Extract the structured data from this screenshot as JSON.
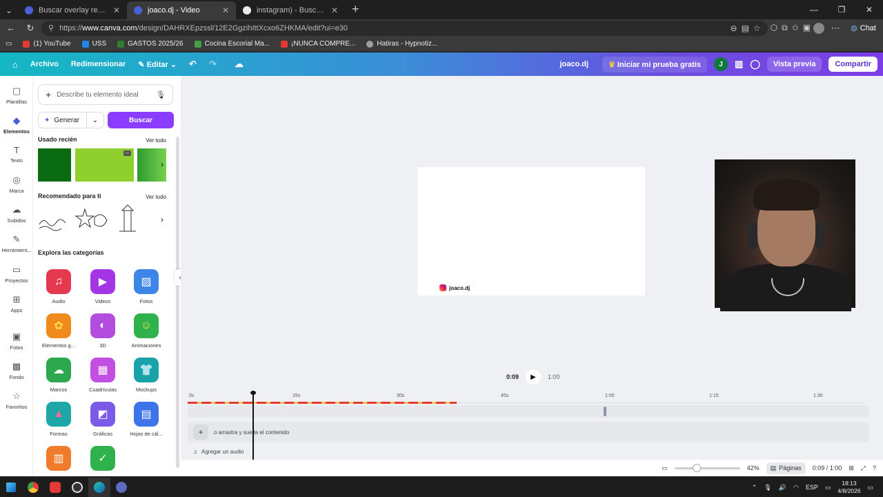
{
  "browser": {
    "tabs": [
      {
        "title": "Buscar overlay redes - Canva",
        "active": false,
        "color": "#4b5fd6"
      },
      {
        "title": "joaco.dj - Video",
        "active": true,
        "color": "#4b5fd6"
      },
      {
        "title": "instagram) - Buscar con Google",
        "active": false,
        "color": "#e8eaed"
      }
    ],
    "url_prefix": "https://",
    "url_host": "www.canva.com",
    "url_path": "/design/DAHRXEpzssl/12E2GgzihIttXcxo6ZHKMA/edit?ui=e30",
    "chat_label": "Chat",
    "bookmarks": [
      {
        "label": "(1) YouTube",
        "color": "#e53935"
      },
      {
        "label": "USS",
        "color": "#1e88e5"
      },
      {
        "label": "GASTOS 2025/26",
        "color": "#2e7d32"
      },
      {
        "label": "Cocina Escorial Ma...",
        "color": "#43a047"
      },
      {
        "label": "¡NUNCA COMPRE...",
        "color": "#e53935"
      },
      {
        "label": "Hatiras - Hypnotiz...",
        "color": "#9e9e9e"
      }
    ]
  },
  "header": {
    "archivo": "Archivo",
    "redimensionar": "Redimensionar",
    "editar": "Editar",
    "project_name": "joaco.dj",
    "trial": "Iniciar mi prueba gratis",
    "avatar_initial": "J",
    "preview": "Vista previa",
    "share": "Compartir"
  },
  "rail": [
    {
      "label": "Plantillas",
      "icon": "template-icon",
      "glyph": "▢"
    },
    {
      "label": "Elementos",
      "icon": "elements-icon",
      "glyph": "◆",
      "active": true
    },
    {
      "label": "Texto",
      "icon": "text-icon",
      "glyph": "T"
    },
    {
      "label": "Marca",
      "icon": "brand-icon",
      "glyph": "◎"
    },
    {
      "label": "Subidos",
      "icon": "upload-icon",
      "glyph": "☁"
    },
    {
      "label": "Herramient...",
      "icon": "tools-icon",
      "glyph": "✎"
    },
    {
      "label": "Proyectos",
      "icon": "folder-icon",
      "glyph": "▭"
    },
    {
      "label": "Apps",
      "icon": "apps-icon",
      "glyph": "⊞"
    },
    {
      "label": "Fotos",
      "icon": "photo-icon",
      "glyph": "▣"
    },
    {
      "label": "Fondo",
      "icon": "background-icon",
      "glyph": "▩"
    },
    {
      "label": "Favoritos",
      "icon": "star-icon",
      "glyph": "☆"
    }
  ],
  "panel": {
    "search_placeholder": "Describe tu elemento ideal",
    "generate": "Generar",
    "search_button": "Buscar",
    "recent_title": "Usado recién",
    "recommended_title": "Recomendado para ti",
    "see_all": "Ver todo",
    "categories_title": "Explora las categorías",
    "categories": [
      {
        "label": "Audio",
        "color": "#e53950",
        "glyph": "♫"
      },
      {
        "label": "Videos",
        "color": "#a335e6",
        "glyph": "▶"
      },
      {
        "label": "Fotos",
        "color": "#3d86e8",
        "glyph": "▨"
      },
      {
        "label": "Elementos g...",
        "color": "#f08a1d",
        "glyph": "✿"
      },
      {
        "label": "3D",
        "color": "#b34de0",
        "glyph": "◐"
      },
      {
        "label": "Animaciones",
        "color": "#2fb24c",
        "glyph": "☺"
      },
      {
        "label": "Marcos",
        "color": "#2ea84e",
        "glyph": "☁"
      },
      {
        "label": "Cuadrículas",
        "color": "#c24fe2",
        "glyph": "▦"
      },
      {
        "label": "Mockups",
        "color": "#19a3a8",
        "glyph": "👕"
      },
      {
        "label": "Formas",
        "color": "#1fa6a6",
        "glyph": "▲"
      },
      {
        "label": "Gráficas",
        "color": "#7a5be8",
        "glyph": "◩"
      },
      {
        "label": "Hojas de cál...",
        "color": "#3d74e8",
        "glyph": "▤"
      }
    ]
  },
  "canvas": {
    "brand_text": "joaco.dj"
  },
  "timeline": {
    "current_time": "0:09",
    "total_time": "1:00",
    "ticks": [
      "0s",
      "15s",
      "30s",
      "45s",
      "1:00",
      "1:15",
      "1:30"
    ],
    "drop_text": "o arrastra y suelta el contenido",
    "audio_text": "Agregar un audio"
  },
  "bottombar": {
    "zoom": "42%",
    "pages": "Páginas",
    "time": "0:09 / 1:00"
  },
  "taskbar": {
    "lang": "ESP",
    "time": "18:13",
    "date": "4/8/2026"
  }
}
